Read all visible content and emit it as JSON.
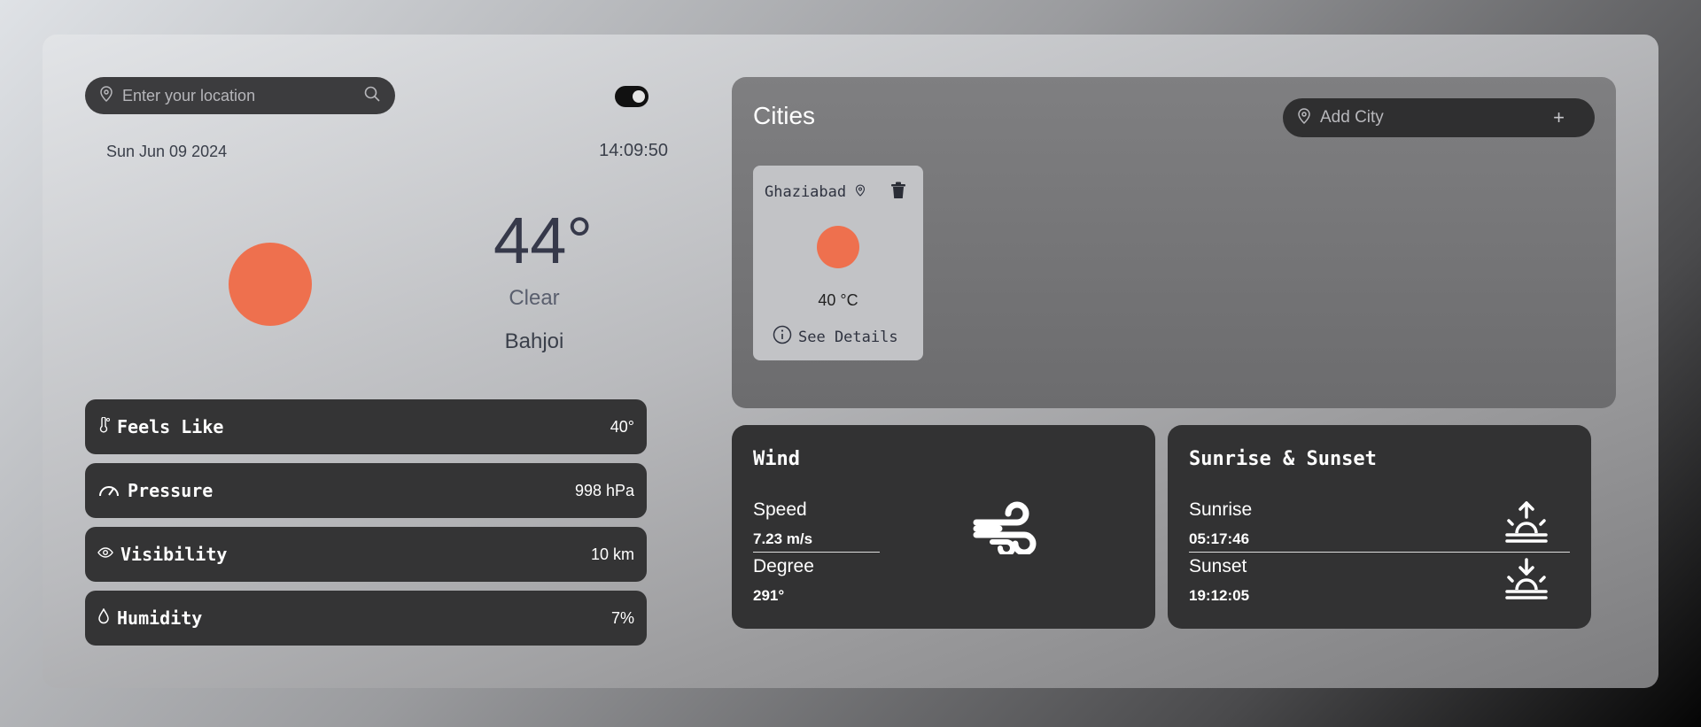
{
  "search": {
    "placeholder": "Enter your location"
  },
  "current": {
    "date": "Sun Jun 09 2024",
    "time": "14:09:50",
    "temperature": "44°",
    "condition": "Clear",
    "location": "Bahjoi"
  },
  "stats": [
    {
      "label": "Feels Like",
      "value": "40°",
      "icon": "thermometer-icon"
    },
    {
      "label": "Pressure",
      "value": "998 hPa",
      "icon": "gauge-icon"
    },
    {
      "label": "Visibility",
      "value": "10 km",
      "icon": "eye-icon"
    },
    {
      "label": "Humidity",
      "value": "7%",
      "icon": "droplet-icon"
    }
  ],
  "cities": {
    "title": "Cities",
    "add_placeholder": "Add City",
    "items": [
      {
        "name": "Ghaziabad",
        "temp": "40 °C",
        "details_label": "See Details"
      }
    ]
  },
  "wind": {
    "title": "Wind",
    "speed_label": "Speed",
    "speed_value": "7.23 m/s",
    "degree_label": "Degree",
    "degree_value": "291°"
  },
  "sun": {
    "title": "Sunrise & Sunset",
    "sunrise_label": "Sunrise",
    "sunrise_value": "05:17:46",
    "sunset_label": "Sunset",
    "sunset_value": "19:12:05"
  },
  "colors": {
    "sun": "#ee704e",
    "card_dark": "#323233"
  }
}
